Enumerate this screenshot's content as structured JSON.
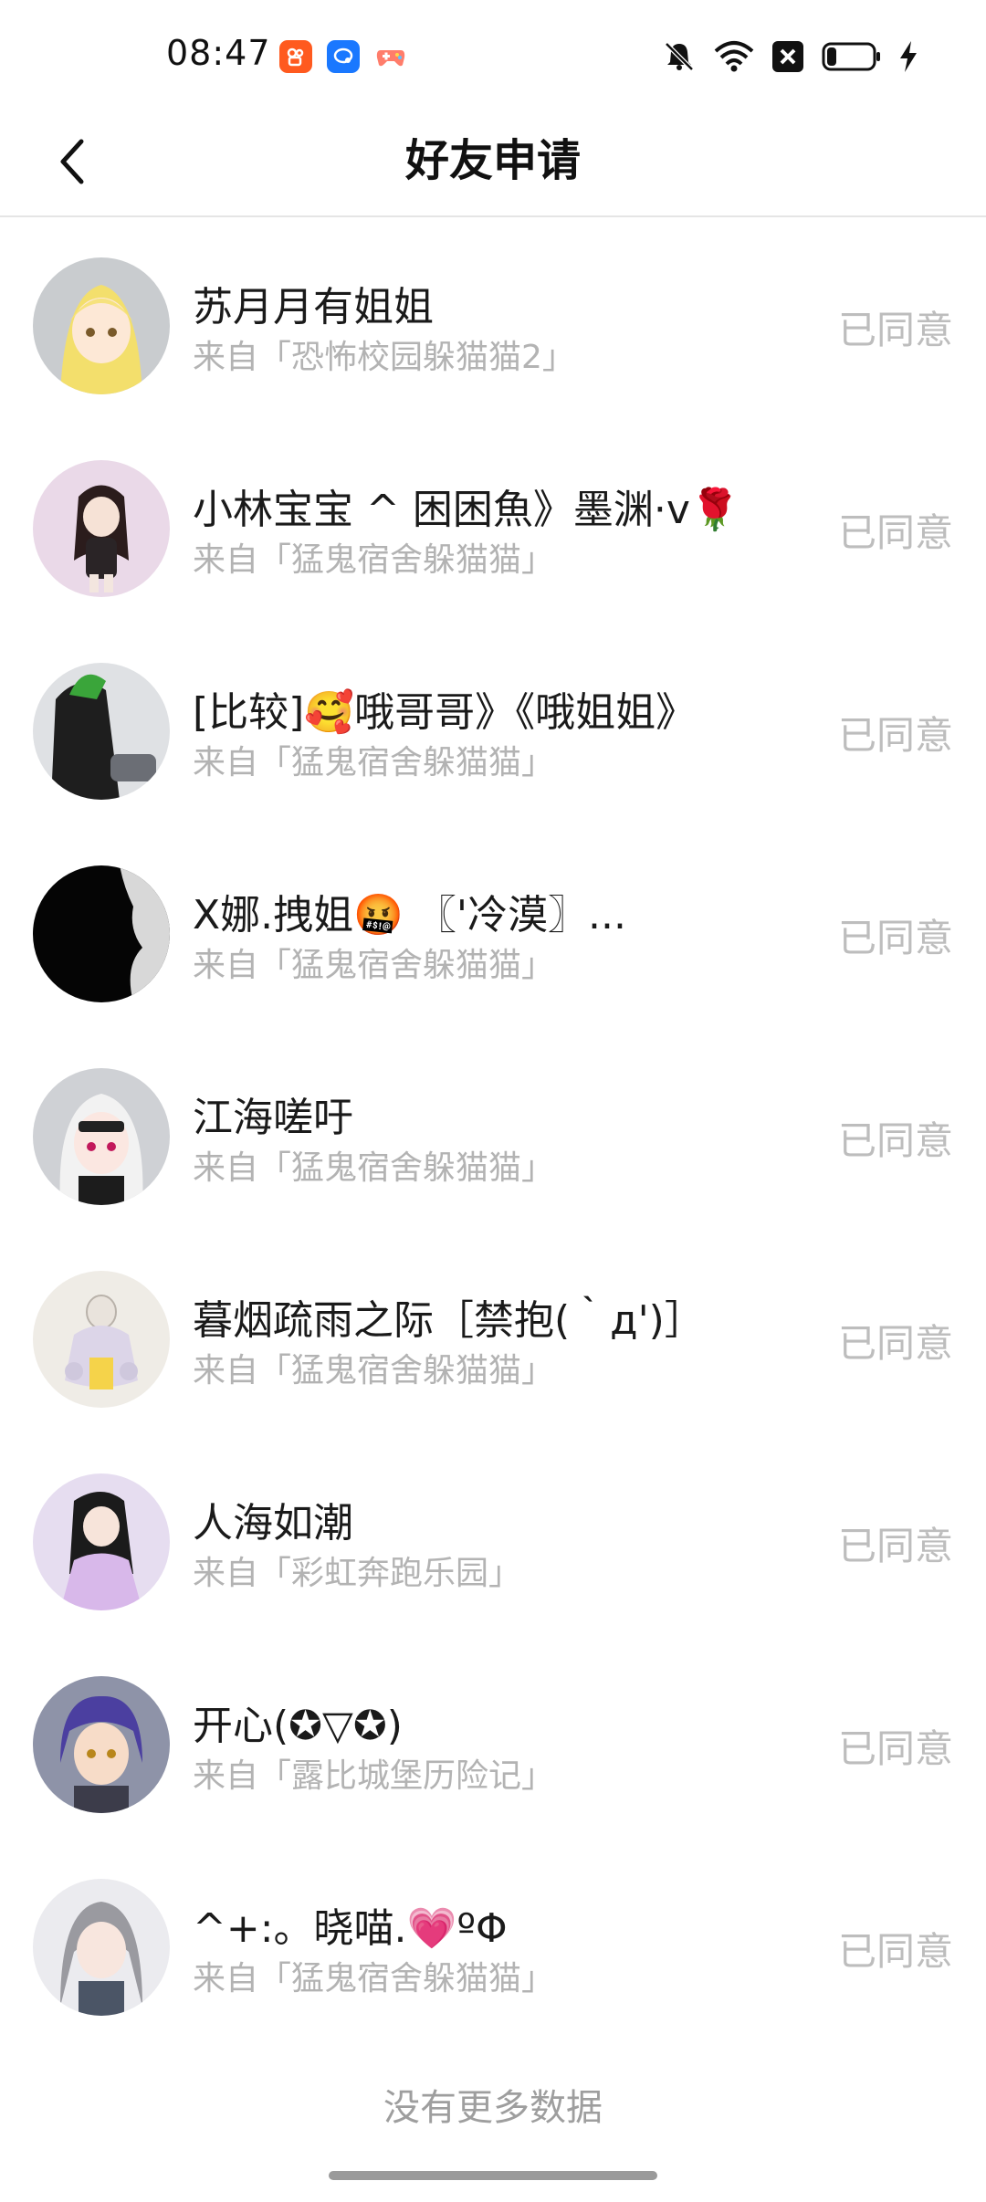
{
  "status_bar": {
    "time": "08:47",
    "app_icons": [
      "kuaishou-icon",
      "chat-bubble-icon",
      "game-controller-icon"
    ],
    "right_icons": [
      "mute-bell-icon",
      "wifi-icon",
      "x-box-icon",
      "battery-icon",
      "charging-bolt-icon"
    ]
  },
  "nav": {
    "title": "好友申请",
    "back_icon": "chevron-left-icon"
  },
  "requests": [
    {
      "name": "苏月月有姐姐",
      "source": "来自「恐怖校园躲猫猫2」",
      "status": "已同意",
      "avatar_color": "#f4e79a"
    },
    {
      "name": "小林宝宝 ^ 困困魚》墨渊·v🌹",
      "source": "来自「猛鬼宿舍躲猫猫」",
      "status": "已同意",
      "avatar_color": "#e8dbe6"
    },
    {
      "name": "[比较]🥰哦哥哥》《哦姐姐》",
      "source": "来自「猛鬼宿舍躲猫猫」",
      "status": "已同意",
      "avatar_color": "#2a2a2a"
    },
    {
      "name": "X娜.拽姐🤬 〖'冷漠〗...",
      "source": "来自「猛鬼宿舍躲猫猫」",
      "status": "已同意",
      "avatar_color": "#0c0c0c"
    },
    {
      "name": "江海嗟吁",
      "source": "来自「猛鬼宿舍躲猫猫」",
      "status": "已同意",
      "avatar_color": "#d9d9d9"
    },
    {
      "name": "暮烟疏雨之际［禁抱(｀д')］",
      "source": "来自「猛鬼宿舍躲猫猫」",
      "status": "已同意",
      "avatar_color": "#ece8e2"
    },
    {
      "name": "人海如潮",
      "source": "来自「彩虹奔跑乐园」",
      "status": "已同意",
      "avatar_color": "#e9e2f2"
    },
    {
      "name": "开心(✪▽✪)",
      "source": "来自「露比城堡历险记」",
      "status": "已同意",
      "avatar_color": "#8a8fb0"
    },
    {
      "name": "^+:。晓喵.💗ºΦ",
      "source": "来自「猛鬼宿舍躲猫猫」",
      "status": "已同意",
      "avatar_color": "#e6e6ea"
    }
  ],
  "footer": {
    "no_more_text": "没有更多数据"
  }
}
